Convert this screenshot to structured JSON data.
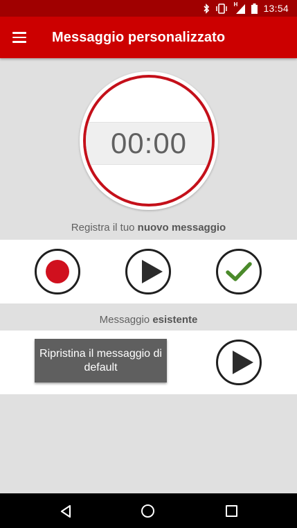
{
  "status_bar": {
    "time": "13:54",
    "icons": [
      "bluetooth-icon",
      "vibrate-icon",
      "signal-h-icon",
      "battery-icon"
    ],
    "network_label": "H"
  },
  "app_bar": {
    "title": "Messaggio personalizzato",
    "menu_icon": "hamburger-menu-icon",
    "color": "#cc0000"
  },
  "timer": {
    "value": "00:00",
    "ring_color": "#c4101a"
  },
  "new_message": {
    "caption_prefix": "Registra il tuo ",
    "caption_bold": "nuovo messaggio",
    "buttons": [
      {
        "name": "record",
        "icon": "record-icon"
      },
      {
        "name": "play",
        "icon": "play-icon"
      },
      {
        "name": "confirm",
        "icon": "check-icon"
      }
    ]
  },
  "existing_message": {
    "caption_prefix": "Messaggio ",
    "caption_bold": "esistente",
    "restore_label": "Ripristina il messaggio di default",
    "play_icon": "play-icon"
  },
  "nav_bar": {
    "items": [
      "back-icon",
      "home-icon",
      "recents-icon"
    ]
  }
}
